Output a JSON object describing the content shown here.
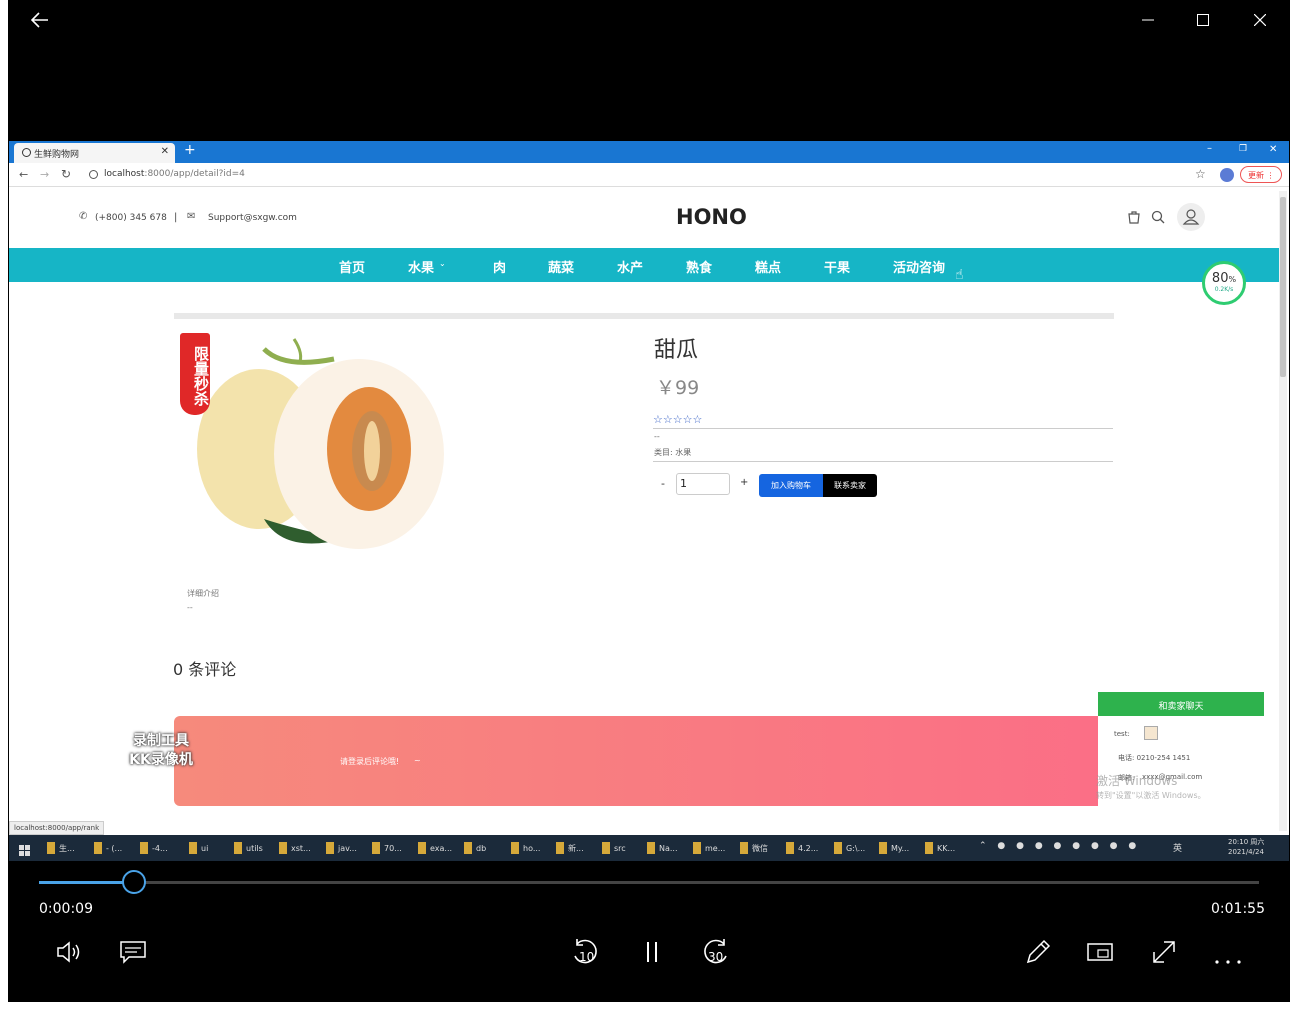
{
  "player": {
    "current_time": "0:00:09",
    "total_time": "0:01:55",
    "progress": 0.078,
    "rewind_seconds": "10",
    "forward_seconds": "30"
  },
  "browser": {
    "tab_title": "生鲜购物网",
    "url_host": "localhost",
    "url_rest": ":8000/app/detail?id=4",
    "update_label": "更新",
    "status_url": "localhost:8000/app/rank"
  },
  "header": {
    "phone": "(+800) 345 678",
    "separator": "|",
    "email": "Support@sxgw.com",
    "logo": "HONO"
  },
  "nav": [
    "首页",
    "水果",
    "肉",
    "蔬菜",
    "水产",
    "熟食",
    "糕点",
    "干果",
    "活动咨询"
  ],
  "speed_badge": {
    "percent": "80",
    "unit": "%",
    "speed": "0.2K/s"
  },
  "product": {
    "badge": "限量秒杀",
    "name": "甜瓜",
    "price": "￥99",
    "rating_stars": 0,
    "desc_dash": "--",
    "category": "类目: 水果",
    "minus": "-",
    "quantity": "1",
    "plus": "+",
    "add_cart": "加入购物车",
    "contact_seller": "联系卖家",
    "detail_title": "详细介绍",
    "detail_dash": "--"
  },
  "comments": {
    "count_label": "0 条评论",
    "login_prompt": "请登录后评论哦!",
    "login_dash": "~"
  },
  "chat": {
    "title": "和卖家聊天",
    "test_label": "test:",
    "phone": "电话: 0210-254 1451",
    "mail_prefix": "邮箱:",
    "mail": "xxxx@gmail.com"
  },
  "watermark": {
    "line1": "录制工具",
    "line2": "KK录像机",
    "activate1": "激活 Windows",
    "activate2": "转到\"设置\"以激活 Windows。"
  },
  "taskbar": {
    "items": [
      "生...",
      "- (...",
      "-4...",
      "ui",
      "utils",
      "xst...",
      "jav...",
      "70...",
      "exa...",
      "db",
      "ho...",
      "新...",
      "src",
      "Na...",
      "me...",
      "微信",
      "4.2...",
      "G:\\...",
      "My...",
      "KK..."
    ],
    "ime": "英",
    "time": "20:10 周六",
    "date": "2021/4/24"
  }
}
